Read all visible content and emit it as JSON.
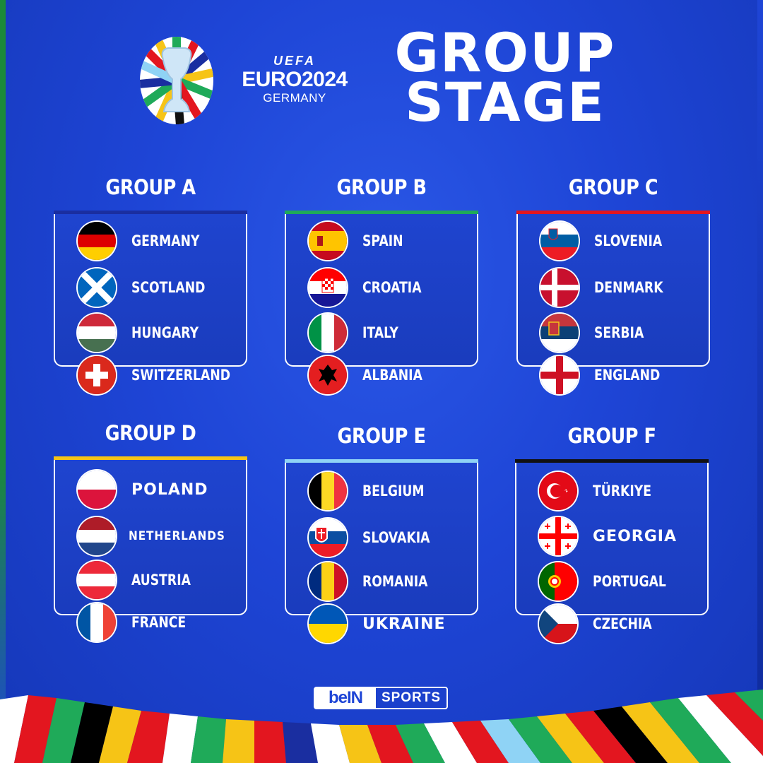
{
  "header": {
    "uefa": "UEFA",
    "euro": "EURO2024",
    "country": "GERMANY",
    "title_line1": "GROUP",
    "title_line2": "STAGE"
  },
  "groups": [
    {
      "title": "GROUP A",
      "accent": "#1a2ea0",
      "teams": [
        "GERMANY",
        "SCOTLAND",
        "HUNGARY",
        "SWITZERLAND"
      ]
    },
    {
      "title": "GROUP B",
      "accent": "#1faa59",
      "teams": [
        "SPAIN",
        "CROATIA",
        "ITALY",
        "ALBANIA"
      ]
    },
    {
      "title": "GROUP C",
      "accent": "#e3161f",
      "teams": [
        "SLOVENIA",
        "DENMARK",
        "SERBIA",
        "ENGLAND"
      ]
    },
    {
      "title": "GROUP D",
      "accent": "#f6c416",
      "teams": [
        "POLAND",
        "NETHERLANDS",
        "AUSTRIA",
        "FRANCE"
      ]
    },
    {
      "title": "GROUP E",
      "accent": "#8fd3f5",
      "teams": [
        "BELGIUM",
        "SLOVAKIA",
        "ROMANIA",
        "UKRAINE"
      ]
    },
    {
      "title": "GROUP F",
      "accent": "#111111",
      "teams": [
        "TÜRKIYE",
        "GEORGIA",
        "PORTUGAL",
        "CZECHIA"
      ]
    }
  ],
  "footer": {
    "bein_left": "beIN",
    "bein_right": "SPORTS"
  }
}
